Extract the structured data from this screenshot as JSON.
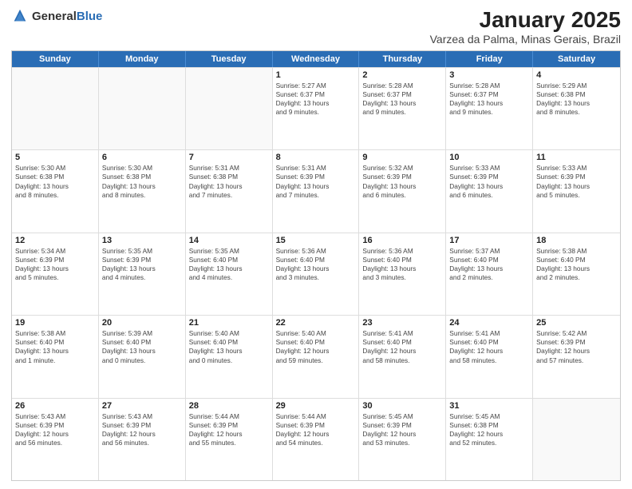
{
  "logo": {
    "text_general": "General",
    "text_blue": "Blue"
  },
  "title": "January 2025",
  "subtitle": "Varzea da Palma, Minas Gerais, Brazil",
  "days_of_week": [
    "Sunday",
    "Monday",
    "Tuesday",
    "Wednesday",
    "Thursday",
    "Friday",
    "Saturday"
  ],
  "weeks": [
    [
      {
        "day": "",
        "lines": []
      },
      {
        "day": "",
        "lines": []
      },
      {
        "day": "",
        "lines": []
      },
      {
        "day": "1",
        "lines": [
          "Sunrise: 5:27 AM",
          "Sunset: 6:37 PM",
          "Daylight: 13 hours",
          "and 9 minutes."
        ]
      },
      {
        "day": "2",
        "lines": [
          "Sunrise: 5:28 AM",
          "Sunset: 6:37 PM",
          "Daylight: 13 hours",
          "and 9 minutes."
        ]
      },
      {
        "day": "3",
        "lines": [
          "Sunrise: 5:28 AM",
          "Sunset: 6:37 PM",
          "Daylight: 13 hours",
          "and 9 minutes."
        ]
      },
      {
        "day": "4",
        "lines": [
          "Sunrise: 5:29 AM",
          "Sunset: 6:38 PM",
          "Daylight: 13 hours",
          "and 8 minutes."
        ]
      }
    ],
    [
      {
        "day": "5",
        "lines": [
          "Sunrise: 5:30 AM",
          "Sunset: 6:38 PM",
          "Daylight: 13 hours",
          "and 8 minutes."
        ]
      },
      {
        "day": "6",
        "lines": [
          "Sunrise: 5:30 AM",
          "Sunset: 6:38 PM",
          "Daylight: 13 hours",
          "and 8 minutes."
        ]
      },
      {
        "day": "7",
        "lines": [
          "Sunrise: 5:31 AM",
          "Sunset: 6:38 PM",
          "Daylight: 13 hours",
          "and 7 minutes."
        ]
      },
      {
        "day": "8",
        "lines": [
          "Sunrise: 5:31 AM",
          "Sunset: 6:39 PM",
          "Daylight: 13 hours",
          "and 7 minutes."
        ]
      },
      {
        "day": "9",
        "lines": [
          "Sunrise: 5:32 AM",
          "Sunset: 6:39 PM",
          "Daylight: 13 hours",
          "and 6 minutes."
        ]
      },
      {
        "day": "10",
        "lines": [
          "Sunrise: 5:33 AM",
          "Sunset: 6:39 PM",
          "Daylight: 13 hours",
          "and 6 minutes."
        ]
      },
      {
        "day": "11",
        "lines": [
          "Sunrise: 5:33 AM",
          "Sunset: 6:39 PM",
          "Daylight: 13 hours",
          "and 5 minutes."
        ]
      }
    ],
    [
      {
        "day": "12",
        "lines": [
          "Sunrise: 5:34 AM",
          "Sunset: 6:39 PM",
          "Daylight: 13 hours",
          "and 5 minutes."
        ]
      },
      {
        "day": "13",
        "lines": [
          "Sunrise: 5:35 AM",
          "Sunset: 6:39 PM",
          "Daylight: 13 hours",
          "and 4 minutes."
        ]
      },
      {
        "day": "14",
        "lines": [
          "Sunrise: 5:35 AM",
          "Sunset: 6:40 PM",
          "Daylight: 13 hours",
          "and 4 minutes."
        ]
      },
      {
        "day": "15",
        "lines": [
          "Sunrise: 5:36 AM",
          "Sunset: 6:40 PM",
          "Daylight: 13 hours",
          "and 3 minutes."
        ]
      },
      {
        "day": "16",
        "lines": [
          "Sunrise: 5:36 AM",
          "Sunset: 6:40 PM",
          "Daylight: 13 hours",
          "and 3 minutes."
        ]
      },
      {
        "day": "17",
        "lines": [
          "Sunrise: 5:37 AM",
          "Sunset: 6:40 PM",
          "Daylight: 13 hours",
          "and 2 minutes."
        ]
      },
      {
        "day": "18",
        "lines": [
          "Sunrise: 5:38 AM",
          "Sunset: 6:40 PM",
          "Daylight: 13 hours",
          "and 2 minutes."
        ]
      }
    ],
    [
      {
        "day": "19",
        "lines": [
          "Sunrise: 5:38 AM",
          "Sunset: 6:40 PM",
          "Daylight: 13 hours",
          "and 1 minute."
        ]
      },
      {
        "day": "20",
        "lines": [
          "Sunrise: 5:39 AM",
          "Sunset: 6:40 PM",
          "Daylight: 13 hours",
          "and 0 minutes."
        ]
      },
      {
        "day": "21",
        "lines": [
          "Sunrise: 5:40 AM",
          "Sunset: 6:40 PM",
          "Daylight: 13 hours",
          "and 0 minutes."
        ]
      },
      {
        "day": "22",
        "lines": [
          "Sunrise: 5:40 AM",
          "Sunset: 6:40 PM",
          "Daylight: 12 hours",
          "and 59 minutes."
        ]
      },
      {
        "day": "23",
        "lines": [
          "Sunrise: 5:41 AM",
          "Sunset: 6:40 PM",
          "Daylight: 12 hours",
          "and 58 minutes."
        ]
      },
      {
        "day": "24",
        "lines": [
          "Sunrise: 5:41 AM",
          "Sunset: 6:40 PM",
          "Daylight: 12 hours",
          "and 58 minutes."
        ]
      },
      {
        "day": "25",
        "lines": [
          "Sunrise: 5:42 AM",
          "Sunset: 6:39 PM",
          "Daylight: 12 hours",
          "and 57 minutes."
        ]
      }
    ],
    [
      {
        "day": "26",
        "lines": [
          "Sunrise: 5:43 AM",
          "Sunset: 6:39 PM",
          "Daylight: 12 hours",
          "and 56 minutes."
        ]
      },
      {
        "day": "27",
        "lines": [
          "Sunrise: 5:43 AM",
          "Sunset: 6:39 PM",
          "Daylight: 12 hours",
          "and 56 minutes."
        ]
      },
      {
        "day": "28",
        "lines": [
          "Sunrise: 5:44 AM",
          "Sunset: 6:39 PM",
          "Daylight: 12 hours",
          "and 55 minutes."
        ]
      },
      {
        "day": "29",
        "lines": [
          "Sunrise: 5:44 AM",
          "Sunset: 6:39 PM",
          "Daylight: 12 hours",
          "and 54 minutes."
        ]
      },
      {
        "day": "30",
        "lines": [
          "Sunrise: 5:45 AM",
          "Sunset: 6:39 PM",
          "Daylight: 12 hours",
          "and 53 minutes."
        ]
      },
      {
        "day": "31",
        "lines": [
          "Sunrise: 5:45 AM",
          "Sunset: 6:38 PM",
          "Daylight: 12 hours",
          "and 52 minutes."
        ]
      },
      {
        "day": "",
        "lines": []
      }
    ]
  ]
}
